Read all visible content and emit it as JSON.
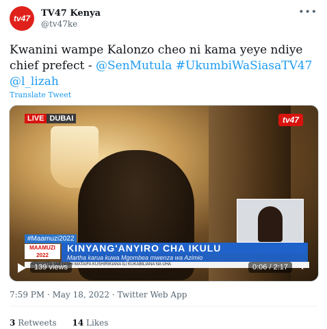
{
  "header": {
    "avatar_text": "tv47",
    "name": "TV47 Kenya",
    "handle": "@tv47ke",
    "more_icon": "ellipsis-icon"
  },
  "tweet": {
    "text": "Kwanini wampe Kalonzo cheo ni kama yeye ndiye chief prefect - ",
    "links": [
      "@SenMutula",
      "#UkumbiWaSiasaTV47",
      "@l_lizah"
    ],
    "translate": "Translate Tweet"
  },
  "video": {
    "live": "LIVE",
    "location": "DUBAI",
    "channel_logo": "tv47",
    "hashtag": "#Maamuzi2022",
    "maamuzi_label": "MAAMUZI 2022",
    "banner": "KINYANG'ANYIRO CHA IKULU",
    "subbanner": "Martha karua kuwa Mgombea mwenza wa Azimio",
    "ticker": "KENYATTA ANEYASHI MATAIFA KUSHIRIKIANA ILI KUKABILIANA NA UHA",
    "views": "139 views",
    "time": "0:06 / 2:17"
  },
  "meta": {
    "timestamp": "7:59 PM · May 18, 2022 · Twitter Web App"
  },
  "stats": {
    "retweets_count": "3",
    "retweets_label": "Retweets",
    "likes_count": "14",
    "likes_label": "Likes"
  },
  "colors": {
    "brand": "#e0211b",
    "link": "#1d9bf0",
    "banner": "#1f62c9"
  }
}
